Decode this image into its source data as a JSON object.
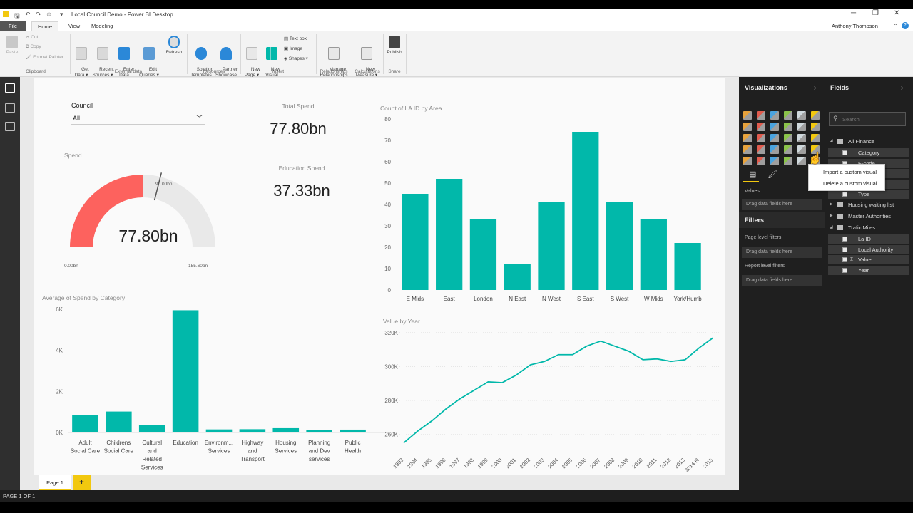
{
  "window": {
    "title": "Local Council Demo - Power BI Desktop",
    "user": "Anthony Thompson"
  },
  "menu": {
    "tabs": [
      {
        "label": "File"
      },
      {
        "label": "Home"
      },
      {
        "label": "View"
      },
      {
        "label": "Modeling"
      }
    ]
  },
  "ribbon": {
    "paste": "Paste",
    "cut": "Cut",
    "copy": "Copy",
    "format_painter": "Format Painter",
    "get_data": "Get\nData ▾",
    "recent_sources": "Recent\nSources ▾",
    "enter_data": "Enter\nData",
    "edit_queries": "Edit\nQueries ▾",
    "refresh": "Refresh",
    "solution_templates": "Solution\nTemplates",
    "partner_showcase": "Partner\nShowcase",
    "new_page": "New\nPage ▾",
    "new_visual": "New\nVisual",
    "text_box": "Text box",
    "image": "Image",
    "shapes": "Shapes ▾",
    "manage_relationships": "Manage\nRelationships",
    "new_measure": "New\nMeasure ▾",
    "publish": "Publish",
    "groups": {
      "clipboard": "Clipboard",
      "external_data": "External data",
      "resources": "Resources",
      "insert": "Insert",
      "relationships": "Relationships",
      "calculations": "Calculations",
      "share": "Share"
    }
  },
  "report": {
    "slicer": {
      "title": "Council",
      "value": "All"
    },
    "total_spend": {
      "title": "Total Spend",
      "value": "77.80bn"
    },
    "education_spend": {
      "title": "Education Spend",
      "value": "37.33bn"
    },
    "gauge": {
      "title": "Spend",
      "value_label": "77.80bn",
      "min_label": "0.00bn",
      "max_label": "155.60bn",
      "target_label": "90.00bn",
      "value": 77.8,
      "min": 0,
      "max": 155.6,
      "target": 90
    }
  },
  "chart_data": [
    {
      "type": "bar",
      "title": "Count of LA ID by Area",
      "categories": [
        "E Mids",
        "East",
        "London",
        "N East",
        "N West",
        "S East",
        "S West",
        "W Mids",
        "York/Humb"
      ],
      "values": [
        45,
        52,
        33,
        12,
        41,
        74,
        41,
        33,
        22
      ],
      "ylim": [
        0,
        80
      ],
      "yticks": [
        "0",
        "10",
        "20",
        "30",
        "40",
        "50",
        "60",
        "70",
        "80"
      ],
      "color": "#01b8aa",
      "grid": false
    },
    {
      "type": "bar",
      "title": "Average of Spend by Category",
      "categories": [
        "Adult\nSocial Care",
        "Childrens\nSocial Care",
        "Cultural\nand\nRelated\nServices",
        "Education",
        "Environm...\nServices",
        "Highway\nand\nTransport",
        "Housing\nServices",
        "Planning\nand Dev\nservices",
        "Public\nHealth"
      ],
      "values": [
        850,
        1020,
        380,
        5950,
        150,
        160,
        210,
        120,
        140
      ],
      "ylim": [
        0,
        6000
      ],
      "yticks": [
        "0K",
        "2K",
        "4K",
        "6K"
      ],
      "color": "#01b8aa",
      "grid": false
    },
    {
      "type": "line",
      "title": "Value by Year",
      "x": [
        "1993",
        "1994",
        "1995",
        "1996",
        "1997",
        "1998",
        "1999",
        "2000",
        "2001",
        "2002",
        "2003",
        "2004",
        "2005",
        "2006",
        "2007",
        "2008",
        "2009",
        "2010",
        "2011",
        "2012",
        "2013",
        "2014 R",
        "2015"
      ],
      "values": [
        255000,
        262000,
        268000,
        275000,
        281000,
        286000,
        291000,
        290500,
        295000,
        301000,
        303000,
        307000,
        307000,
        312000,
        315000,
        312000,
        309000,
        304000,
        304500,
        303000,
        304000,
        311000,
        317000
      ],
      "ylim": [
        254000,
        322000
      ],
      "yticks": [
        {
          "v": 260000,
          "label": "260K"
        },
        {
          "v": 280000,
          "label": "280K"
        },
        {
          "v": 300000,
          "label": "300K"
        },
        {
          "v": 320000,
          "label": "320K"
        }
      ],
      "color": "#01b8aa",
      "grid": true
    }
  ],
  "visualizations": {
    "title": "Visualizations",
    "values_label": "Values",
    "drag_values": "Drag data fields here",
    "popup": {
      "import": "Import a custom visual",
      "delete": "Delete a custom visual"
    }
  },
  "filters": {
    "title": "Filters",
    "page_level": "Page level filters",
    "drag_page": "Drag data fields here",
    "report_level": "Report level filters",
    "drag_report": "Drag data fields here"
  },
  "fields": {
    "title": "Fields",
    "search_placeholder": "Search",
    "tables": [
      {
        "name": "All Finance",
        "expanded": true,
        "items": [
          "Category",
          "E-code",
          "",
          "",
          "Type"
        ]
      },
      {
        "name": "Housing waiting list",
        "expanded": false,
        "items": []
      },
      {
        "name": "Master Authorities",
        "expanded": false,
        "items": []
      },
      {
        "name": "Trafic Miles",
        "expanded": true,
        "items": [
          "La ID",
          "Local Authority",
          "Value",
          "Year"
        ]
      }
    ]
  },
  "pages": {
    "tabs": [
      "Page 1"
    ],
    "add": "+"
  },
  "status": {
    "text": "PAGE 1 OF 1"
  },
  "colors": {
    "accent": "#01b8aa",
    "gauge_fill": "#fd625e",
    "gauge_track": "#e9e9e9",
    "page_add": "#f2c80f"
  }
}
